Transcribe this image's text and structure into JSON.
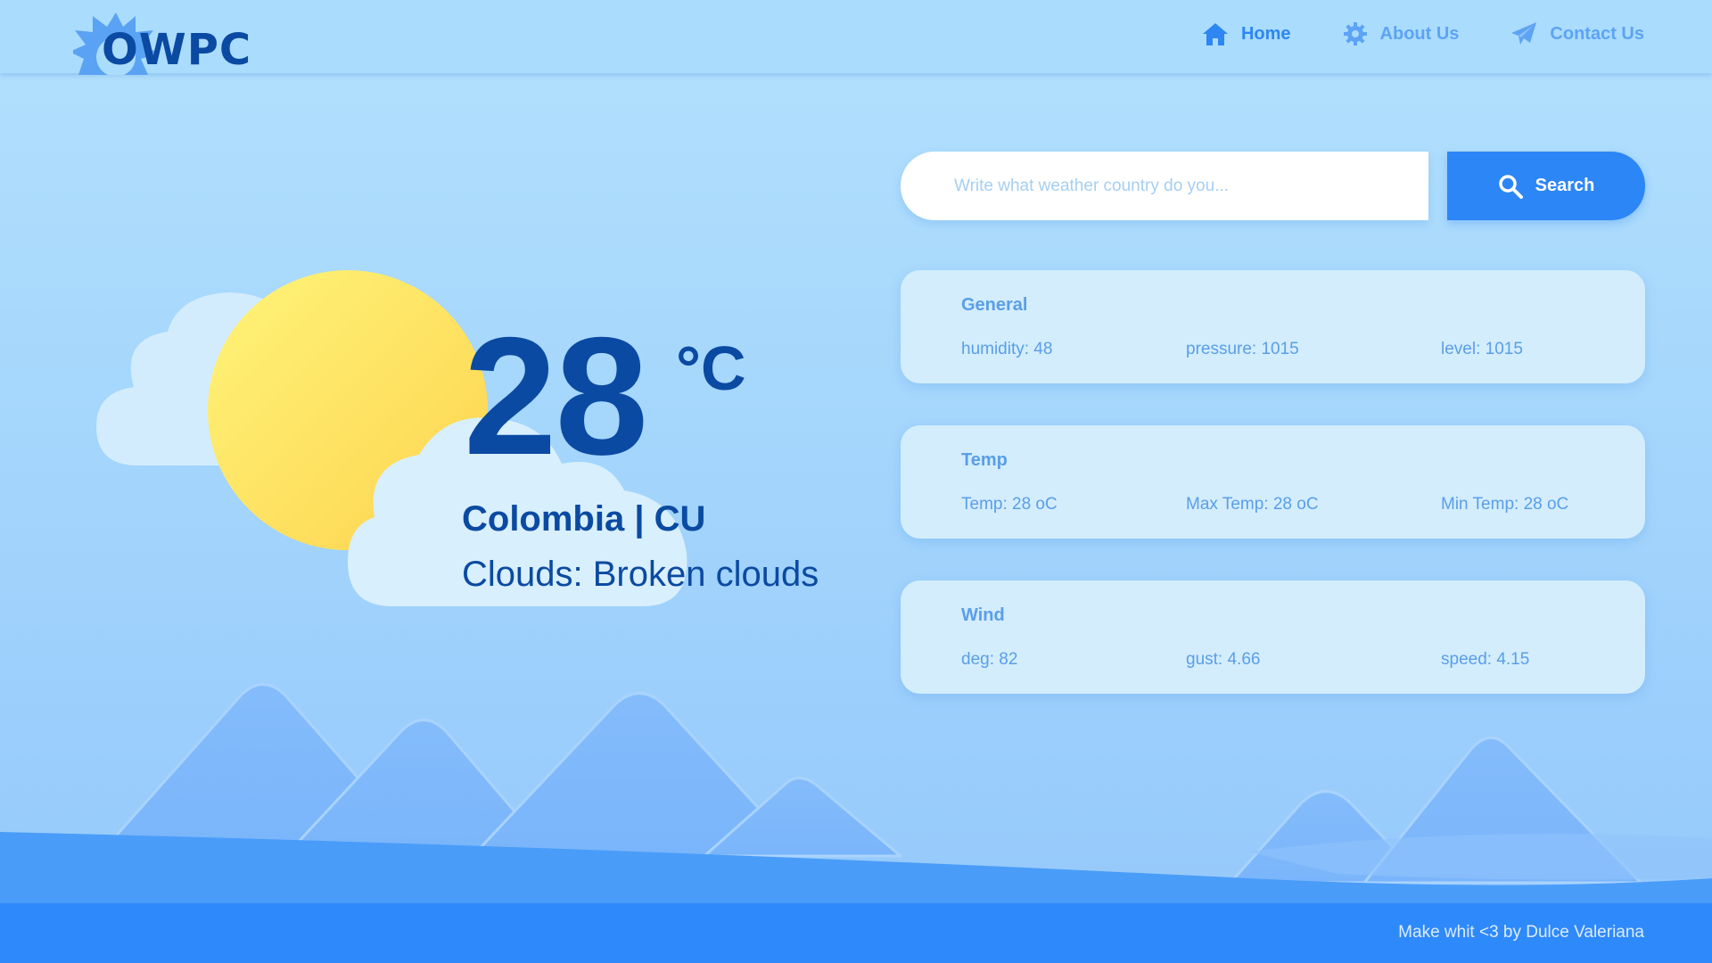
{
  "header": {
    "logo_text": "OWPC",
    "nav": [
      {
        "label": "Home",
        "icon": "home-icon",
        "active": true
      },
      {
        "label": "About Us",
        "icon": "gear-icon",
        "active": false
      },
      {
        "label": "Contact Us",
        "icon": "paper-plane-icon",
        "active": false
      }
    ]
  },
  "weather": {
    "temperature": "28",
    "unit": "°C",
    "location": "Colombia | CU",
    "condition": "Clouds: Broken clouds",
    "illustration_icon": "sun-behind-clouds-icon"
  },
  "search": {
    "placeholder": "Write what weather country do you...",
    "value": "",
    "button_label": "Search",
    "button_icon": "search-icon"
  },
  "cards": [
    {
      "title": "General",
      "items": [
        "humidity: 48",
        "pressure: 1015",
        "level: 1015"
      ]
    },
    {
      "title": "Temp",
      "items": [
        "Temp: 28 oC",
        "Max Temp: 28 oC",
        "Min Temp: 28 oC"
      ]
    },
    {
      "title": "Wind",
      "items": [
        "deg: 82",
        "gust: 4.66",
        "speed: 4.15"
      ]
    }
  ],
  "footer": {
    "text": "Make whit <3 by Dulce Valeriana"
  },
  "colors": {
    "primary": "#2e86f2",
    "dark_text": "#0b4aa2",
    "card_bg": "#d3edfd",
    "footer_bg": "#2e89fb",
    "sun": "#fde56a"
  }
}
